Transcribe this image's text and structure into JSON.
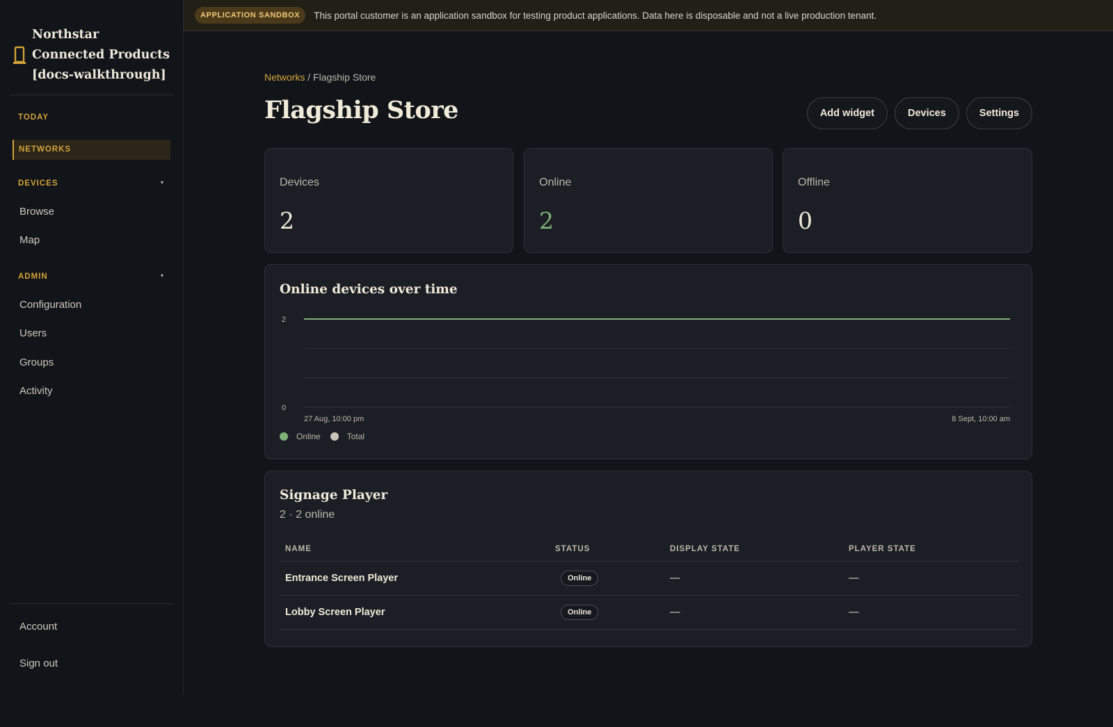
{
  "sidebar": {
    "brand": "Northstar Connected Products [docs-walkthrough]",
    "today": "TODAY",
    "networks": "NETWORKS",
    "devices_section": "DEVICES",
    "devices_items": [
      "Browse",
      "Map"
    ],
    "admin_section": "ADMIN",
    "admin_items": [
      "Configuration",
      "Users",
      "Groups",
      "Activity"
    ],
    "caret": "▾",
    "account": "Account",
    "sign_out": "Sign out"
  },
  "banner": {
    "badge": "APPLICATION SANDBOX",
    "text": "This portal customer is an application sandbox for testing product applications. Data here is disposable and not a live production tenant."
  },
  "breadcrumb": {
    "parent": "Networks",
    "separator": " / ",
    "current": "Flagship Store"
  },
  "page_title": "Flagship Store",
  "actions": {
    "add_widget": "Add widget",
    "devices": "Devices",
    "settings": "Settings"
  },
  "stats": [
    {
      "label": "Devices",
      "value": "2"
    },
    {
      "label": "Online",
      "value": "2"
    },
    {
      "label": "Offline",
      "value": "0"
    }
  ],
  "chart": {
    "title": "Online devices over time",
    "legend": {
      "online": "Online",
      "total": "Total"
    },
    "colors": {
      "online": "#7fb07a",
      "total": "#c9c4b8",
      "grid": "#2e333a"
    }
  },
  "chart_data": {
    "type": "line",
    "title": "Online devices over time",
    "x": [
      "27 Aug, 10:00 pm",
      "8 Sept, 10:00 am"
    ],
    "yticks": [
      "2",
      "0"
    ],
    "ylim": [
      0,
      2
    ],
    "series": [
      {
        "name": "Online",
        "values": [
          2,
          2
        ]
      },
      {
        "name": "Total",
        "values": [
          2,
          2
        ]
      }
    ],
    "grid": true,
    "legend": "bottom-left"
  },
  "group": {
    "title": "Signage Player",
    "subtitle": "2 · 2 online",
    "columns": [
      "NAME",
      "STATUS",
      "DISPLAY STATE",
      "PLAYER STATE"
    ],
    "rows": [
      {
        "name": "Entrance Screen Player",
        "status": "Online",
        "display": "—",
        "player": "—"
      },
      {
        "name": "Lobby Screen Player",
        "status": "Online",
        "display": "—",
        "player": "—"
      }
    ]
  },
  "theme": {
    "accent": "#d4a23a",
    "online_green": "#7fb07a",
    "background": "#111418",
    "card": "#1b1f25"
  }
}
